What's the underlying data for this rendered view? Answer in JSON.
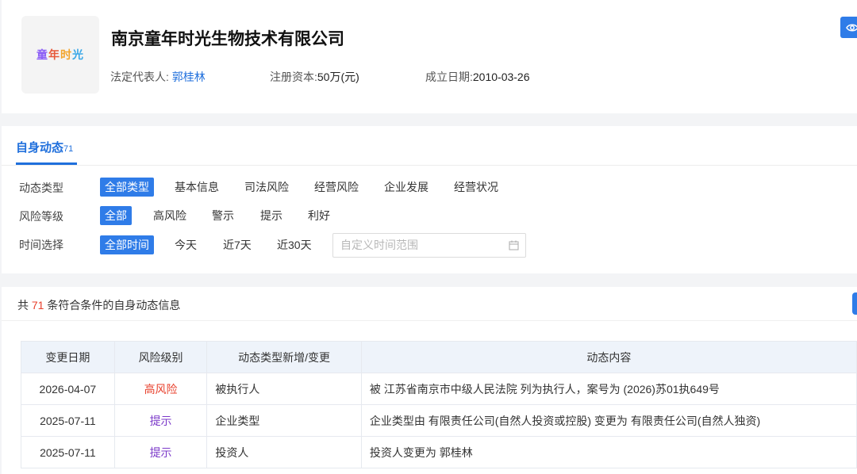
{
  "company": {
    "logo_chars": [
      "童",
      "年",
      "时",
      "光"
    ],
    "name": "南京童年时光生物技术有限公司",
    "legal_rep_label": "法定代表人:",
    "legal_rep": "郭桂林",
    "capital_label": "注册资本:",
    "capital": "50万(元)",
    "founded_label": "成立日期:",
    "founded": "2010-03-26"
  },
  "tab": {
    "label": "自身动态",
    "count": "71"
  },
  "filters": {
    "type": {
      "label": "动态类型",
      "options": [
        "全部类型",
        "基本信息",
        "司法风险",
        "经营风险",
        "企业发展",
        "经营状况"
      ],
      "active": 0
    },
    "risk": {
      "label": "风险等级",
      "options": [
        "全部",
        "高风险",
        "警示",
        "提示",
        "利好"
      ],
      "active": 0
    },
    "time": {
      "label": "时间选择",
      "options": [
        "全部时间",
        "今天",
        "近7天",
        "近30天"
      ],
      "active": 0,
      "date_placeholder": "自定义时间范围"
    }
  },
  "summary": {
    "prefix": "共 ",
    "count": "71",
    "suffix": " 条符合条件的自身动态信息"
  },
  "table": {
    "headers": [
      "变更日期",
      "风险级别",
      "动态类型新增/变更",
      "动态内容"
    ],
    "rows": [
      {
        "date": "2026-04-07",
        "risk": "高风险",
        "type": "被执行人",
        "content": "被 江苏省南京市中级人民法院 列为执行人，案号为 (2026)苏01执649号"
      },
      {
        "date": "2025-07-11",
        "risk": "提示",
        "type": "企业类型",
        "content": "企业类型由 有限责任公司(自然人投资或控股) 变更为 有限责任公司(自然人独资)"
      },
      {
        "date": "2025-07-11",
        "risk": "提示",
        "type": "投资人",
        "content": "投资人变更为 郭桂林"
      }
    ]
  },
  "colors": {
    "accent": "#2f7ce8",
    "high_risk": "#e8412d",
    "tip": "#7b39c9"
  }
}
